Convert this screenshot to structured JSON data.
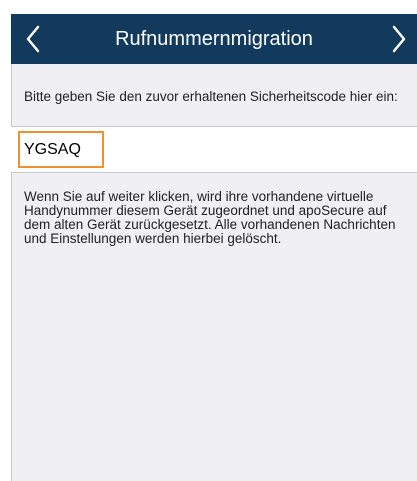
{
  "navbar": {
    "title": "Rufnummernmigration",
    "back_icon": "chevron-left-icon",
    "forward_icon": "chevron-right-icon",
    "background_color": "#123a5c",
    "text_color": "#ffffff"
  },
  "form": {
    "instruction": "Bitte geben Sie den zuvor erhaltenen Sicherheitscode hier ein:",
    "code_value": "YGSAQ",
    "focus_color": "#f0922e",
    "info_text": "Wenn Sie auf weiter klicken, wird ihre vorhandene virtuelle Handynummer diesem Gerät zugeordnet und apoSecure auf dem alten Gerät zurückgesetzt. Alle vorhandenen Nachrichten und Einstellungen werden hierbei gelöscht."
  },
  "background_color": "#efeff4"
}
